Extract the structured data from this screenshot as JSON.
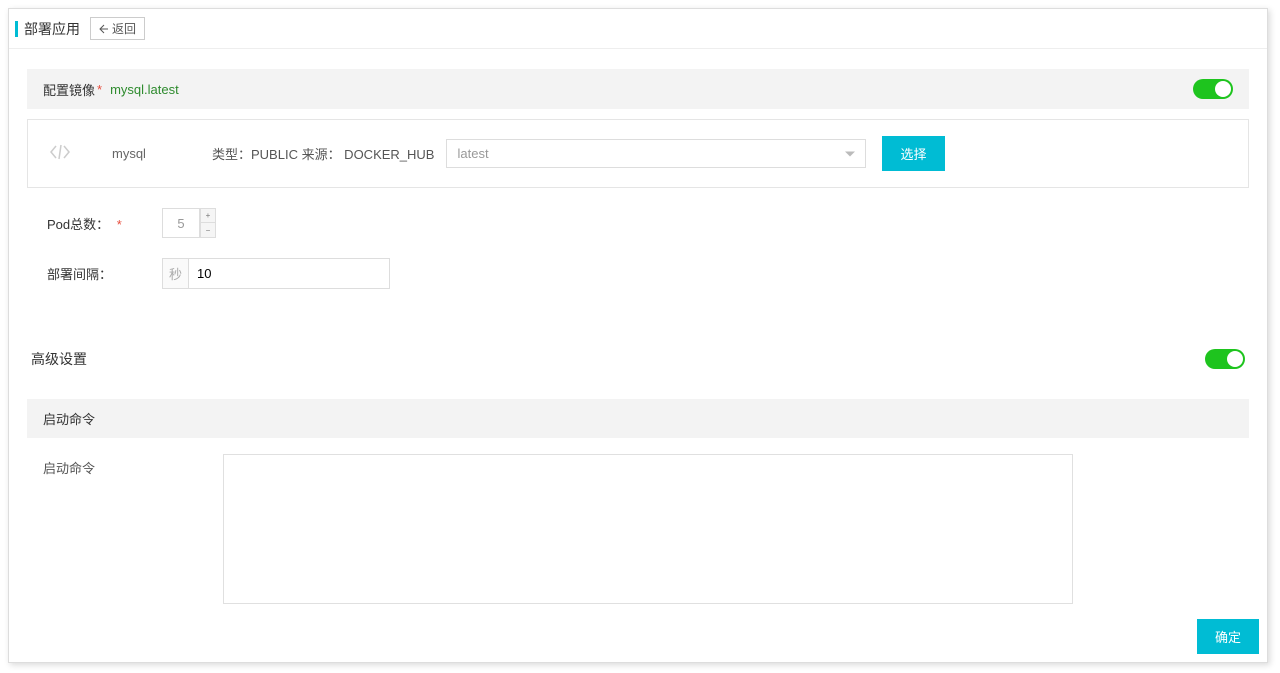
{
  "header": {
    "title": "部署应用",
    "back_label": "返回"
  },
  "image_section": {
    "title": "配置镜像",
    "image_full": "mysql.latest",
    "image_name": "mysql",
    "type_source_text": "类型：PUBLIC 来源： DOCKER_HUB",
    "tag_value": "latest",
    "select_label": "选择"
  },
  "pod": {
    "label": "Pod总数：",
    "value": "5"
  },
  "interval": {
    "label": "部署间隔：",
    "unit": "秒",
    "value": "10"
  },
  "advanced": {
    "title": "高级设置"
  },
  "startup": {
    "section_title": "启动命令",
    "label": "启动命令",
    "value": ""
  },
  "footer": {
    "confirm_label": "确定"
  }
}
